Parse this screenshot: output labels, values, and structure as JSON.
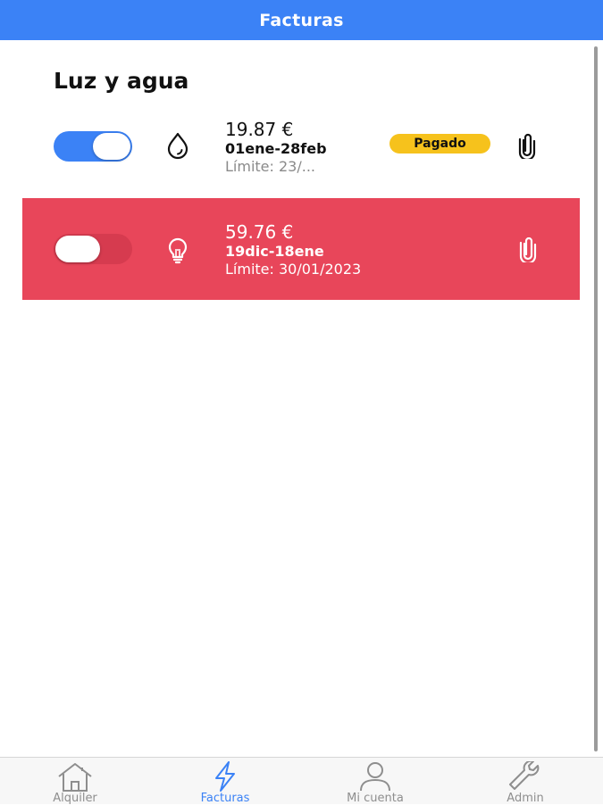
{
  "header": {
    "title": "Facturas"
  },
  "section": {
    "title": "Luz y agua"
  },
  "bills": [
    {
      "amount": "19.87 €",
      "period": "01ene-28feb",
      "limit": "Límite: 23/...",
      "status": "Pagado",
      "type_icon": "water-drop-icon",
      "toggle_on": true
    },
    {
      "amount": "59.76 €",
      "period": "19dic-18ene",
      "limit": "Límite: 30/01/2023",
      "status": "",
      "type_icon": "lightbulb-icon",
      "toggle_on": false
    }
  ],
  "tabs": [
    {
      "label": "Alquiler",
      "icon": "home-icon",
      "active": false
    },
    {
      "label": "Facturas",
      "icon": "lightning-icon",
      "active": true
    },
    {
      "label": "Mi cuenta",
      "icon": "user-icon",
      "active": false
    },
    {
      "label": "Admin",
      "icon": "wrench-icon",
      "active": false
    }
  ],
  "colors": {
    "primary": "#3b82f6",
    "unpaid_row": "#e8465a",
    "paid_badge": "#f6c21c",
    "inactive_tab": "#8e8e8e"
  }
}
